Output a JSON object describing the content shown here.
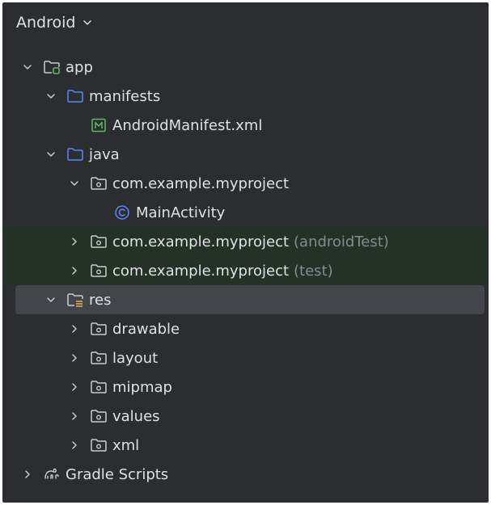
{
  "header": {
    "title": "Android"
  },
  "tree": [
    {
      "key": "app",
      "label": "app",
      "suffix": "",
      "depth": 0,
      "arrow": "down",
      "icon": "module-folder-icon",
      "state": ""
    },
    {
      "key": "manifests",
      "label": "manifests",
      "suffix": "",
      "depth": 1,
      "arrow": "down",
      "icon": "folder-icon",
      "state": ""
    },
    {
      "key": "androidmanifest",
      "label": "AndroidManifest.xml",
      "suffix": "",
      "depth": 2,
      "arrow": "none",
      "icon": "manifest-file-icon",
      "state": ""
    },
    {
      "key": "java",
      "label": "java",
      "suffix": "",
      "depth": 1,
      "arrow": "down",
      "icon": "folder-icon",
      "state": ""
    },
    {
      "key": "pkg-main",
      "label": "com.example.myproject",
      "suffix": "",
      "depth": 2,
      "arrow": "down",
      "icon": "package-icon",
      "state": ""
    },
    {
      "key": "mainactivity",
      "label": "MainActivity",
      "suffix": "",
      "depth": 3,
      "arrow": "none",
      "icon": "class-icon",
      "state": ""
    },
    {
      "key": "pkg-androidtest",
      "label": "com.example.myproject",
      "suffix": "(androidTest)",
      "depth": 2,
      "arrow": "right",
      "icon": "package-icon",
      "state": "green"
    },
    {
      "key": "pkg-test",
      "label": "com.example.myproject",
      "suffix": "(test)",
      "depth": 2,
      "arrow": "right",
      "icon": "package-icon",
      "state": "green"
    },
    {
      "key": "res",
      "label": "res",
      "suffix": "",
      "depth": 1,
      "arrow": "down",
      "icon": "res-folder-icon",
      "state": "selected"
    },
    {
      "key": "drawable",
      "label": "drawable",
      "suffix": "",
      "depth": 2,
      "arrow": "right",
      "icon": "package-icon",
      "state": ""
    },
    {
      "key": "layout",
      "label": "layout",
      "suffix": "",
      "depth": 2,
      "arrow": "right",
      "icon": "package-icon",
      "state": ""
    },
    {
      "key": "mipmap",
      "label": "mipmap",
      "suffix": "",
      "depth": 2,
      "arrow": "right",
      "icon": "package-icon",
      "state": ""
    },
    {
      "key": "values",
      "label": "values",
      "suffix": "",
      "depth": 2,
      "arrow": "right",
      "icon": "package-icon",
      "state": ""
    },
    {
      "key": "xml",
      "label": "xml",
      "suffix": "",
      "depth": 2,
      "arrow": "right",
      "icon": "package-icon",
      "state": ""
    },
    {
      "key": "gradle",
      "label": "Gradle Scripts",
      "suffix": "",
      "depth": 0,
      "arrow": "right",
      "icon": "gradle-icon",
      "state": ""
    }
  ],
  "colors": {
    "background": "#2b2d30",
    "text": "#dfe1e5",
    "muted": "#868a91",
    "folder_blue": "#548af7",
    "manifest_green": "#5fb865",
    "module_green": "#5fb865",
    "res_yellow": "#d6ae58",
    "selected_row": "#43454a",
    "test_row": "#243126"
  }
}
